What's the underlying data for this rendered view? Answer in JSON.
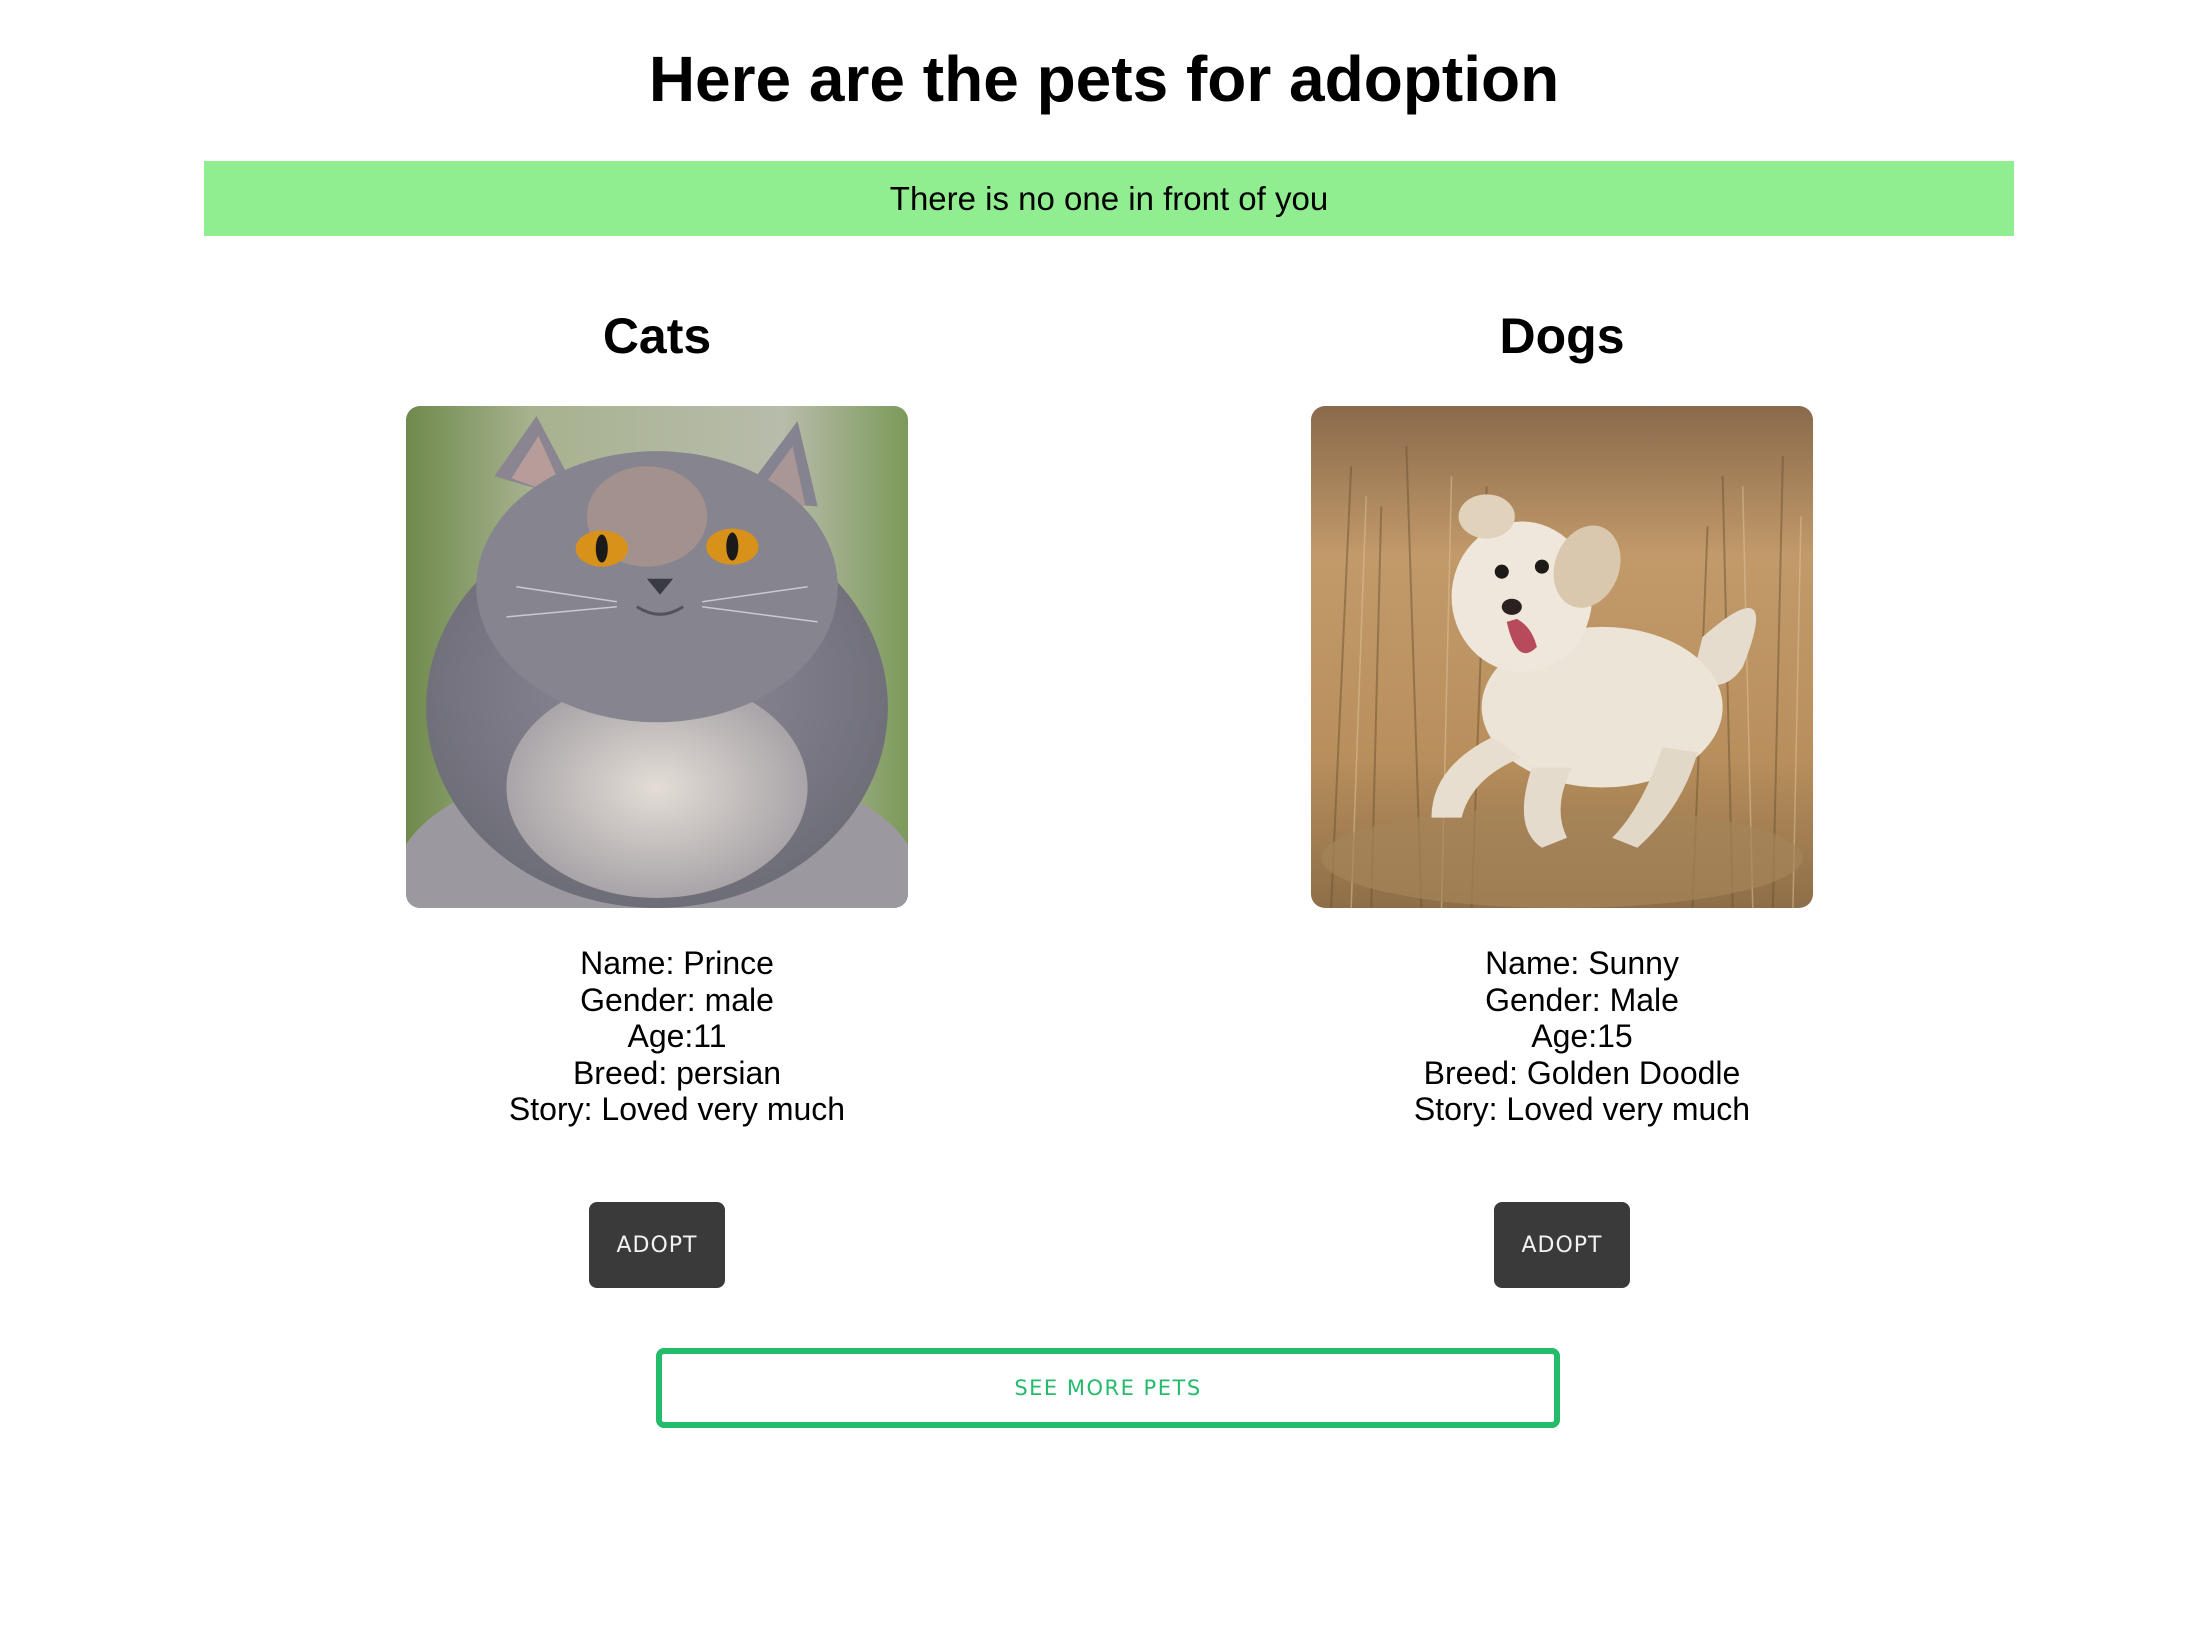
{
  "page": {
    "title": "Here are the pets for adoption"
  },
  "queue": {
    "message": "There is no one in front of you",
    "color": "#90ee90"
  },
  "cats": {
    "heading": "Cats",
    "photo_icon": "persian-cat-photo",
    "name": "Name: Prince",
    "gender": "Gender: male",
    "age": "Age:11",
    "breed": "Breed: persian",
    "story": "Story: Loved very much",
    "adopt_label": "ADOPT"
  },
  "dogs": {
    "heading": "Dogs",
    "photo_icon": "golden-doodle-photo",
    "name": "Name: Sunny",
    "gender": "Gender: Male",
    "age": "Age:15",
    "breed": "Breed: Golden Doodle",
    "story": "Story: Loved very much",
    "adopt_label": "ADOPT"
  },
  "actions": {
    "see_more_label": "SEE MORE PETS"
  },
  "colors": {
    "adopt_button": "#3a3a3a",
    "see_more_accent": "#24bb6a"
  }
}
